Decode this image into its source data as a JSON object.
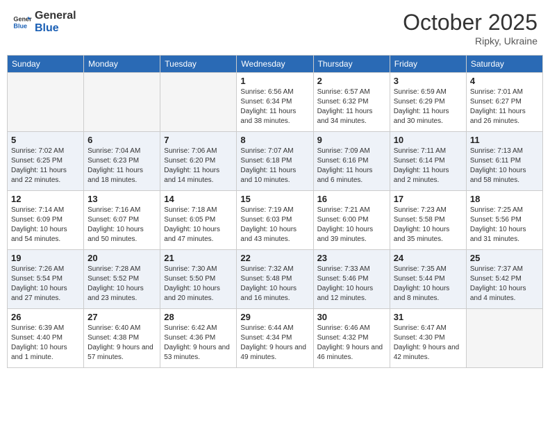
{
  "header": {
    "logo_general": "General",
    "logo_blue": "Blue",
    "title": "October 2025",
    "location": "Ripky, Ukraine"
  },
  "weekdays": [
    "Sunday",
    "Monday",
    "Tuesday",
    "Wednesday",
    "Thursday",
    "Friday",
    "Saturday"
  ],
  "weeks": [
    [
      {
        "day": "",
        "info": ""
      },
      {
        "day": "",
        "info": ""
      },
      {
        "day": "",
        "info": ""
      },
      {
        "day": "1",
        "info": "Sunrise: 6:56 AM\nSunset: 6:34 PM\nDaylight: 11 hours and 38 minutes."
      },
      {
        "day": "2",
        "info": "Sunrise: 6:57 AM\nSunset: 6:32 PM\nDaylight: 11 hours and 34 minutes."
      },
      {
        "day": "3",
        "info": "Sunrise: 6:59 AM\nSunset: 6:29 PM\nDaylight: 11 hours and 30 minutes."
      },
      {
        "day": "4",
        "info": "Sunrise: 7:01 AM\nSunset: 6:27 PM\nDaylight: 11 hours and 26 minutes."
      }
    ],
    [
      {
        "day": "5",
        "info": "Sunrise: 7:02 AM\nSunset: 6:25 PM\nDaylight: 11 hours and 22 minutes."
      },
      {
        "day": "6",
        "info": "Sunrise: 7:04 AM\nSunset: 6:23 PM\nDaylight: 11 hours and 18 minutes."
      },
      {
        "day": "7",
        "info": "Sunrise: 7:06 AM\nSunset: 6:20 PM\nDaylight: 11 hours and 14 minutes."
      },
      {
        "day": "8",
        "info": "Sunrise: 7:07 AM\nSunset: 6:18 PM\nDaylight: 11 hours and 10 minutes."
      },
      {
        "day": "9",
        "info": "Sunrise: 7:09 AM\nSunset: 6:16 PM\nDaylight: 11 hours and 6 minutes."
      },
      {
        "day": "10",
        "info": "Sunrise: 7:11 AM\nSunset: 6:14 PM\nDaylight: 11 hours and 2 minutes."
      },
      {
        "day": "11",
        "info": "Sunrise: 7:13 AM\nSunset: 6:11 PM\nDaylight: 10 hours and 58 minutes."
      }
    ],
    [
      {
        "day": "12",
        "info": "Sunrise: 7:14 AM\nSunset: 6:09 PM\nDaylight: 10 hours and 54 minutes."
      },
      {
        "day": "13",
        "info": "Sunrise: 7:16 AM\nSunset: 6:07 PM\nDaylight: 10 hours and 50 minutes."
      },
      {
        "day": "14",
        "info": "Sunrise: 7:18 AM\nSunset: 6:05 PM\nDaylight: 10 hours and 47 minutes."
      },
      {
        "day": "15",
        "info": "Sunrise: 7:19 AM\nSunset: 6:03 PM\nDaylight: 10 hours and 43 minutes."
      },
      {
        "day": "16",
        "info": "Sunrise: 7:21 AM\nSunset: 6:00 PM\nDaylight: 10 hours and 39 minutes."
      },
      {
        "day": "17",
        "info": "Sunrise: 7:23 AM\nSunset: 5:58 PM\nDaylight: 10 hours and 35 minutes."
      },
      {
        "day": "18",
        "info": "Sunrise: 7:25 AM\nSunset: 5:56 PM\nDaylight: 10 hours and 31 minutes."
      }
    ],
    [
      {
        "day": "19",
        "info": "Sunrise: 7:26 AM\nSunset: 5:54 PM\nDaylight: 10 hours and 27 minutes."
      },
      {
        "day": "20",
        "info": "Sunrise: 7:28 AM\nSunset: 5:52 PM\nDaylight: 10 hours and 23 minutes."
      },
      {
        "day": "21",
        "info": "Sunrise: 7:30 AM\nSunset: 5:50 PM\nDaylight: 10 hours and 20 minutes."
      },
      {
        "day": "22",
        "info": "Sunrise: 7:32 AM\nSunset: 5:48 PM\nDaylight: 10 hours and 16 minutes."
      },
      {
        "day": "23",
        "info": "Sunrise: 7:33 AM\nSunset: 5:46 PM\nDaylight: 10 hours and 12 minutes."
      },
      {
        "day": "24",
        "info": "Sunrise: 7:35 AM\nSunset: 5:44 PM\nDaylight: 10 hours and 8 minutes."
      },
      {
        "day": "25",
        "info": "Sunrise: 7:37 AM\nSunset: 5:42 PM\nDaylight: 10 hours and 4 minutes."
      }
    ],
    [
      {
        "day": "26",
        "info": "Sunrise: 6:39 AM\nSunset: 4:40 PM\nDaylight: 10 hours and 1 minute."
      },
      {
        "day": "27",
        "info": "Sunrise: 6:40 AM\nSunset: 4:38 PM\nDaylight: 9 hours and 57 minutes."
      },
      {
        "day": "28",
        "info": "Sunrise: 6:42 AM\nSunset: 4:36 PM\nDaylight: 9 hours and 53 minutes."
      },
      {
        "day": "29",
        "info": "Sunrise: 6:44 AM\nSunset: 4:34 PM\nDaylight: 9 hours and 49 minutes."
      },
      {
        "day": "30",
        "info": "Sunrise: 6:46 AM\nSunset: 4:32 PM\nDaylight: 9 hours and 46 minutes."
      },
      {
        "day": "31",
        "info": "Sunrise: 6:47 AM\nSunset: 4:30 PM\nDaylight: 9 hours and 42 minutes."
      },
      {
        "day": "",
        "info": ""
      }
    ]
  ]
}
